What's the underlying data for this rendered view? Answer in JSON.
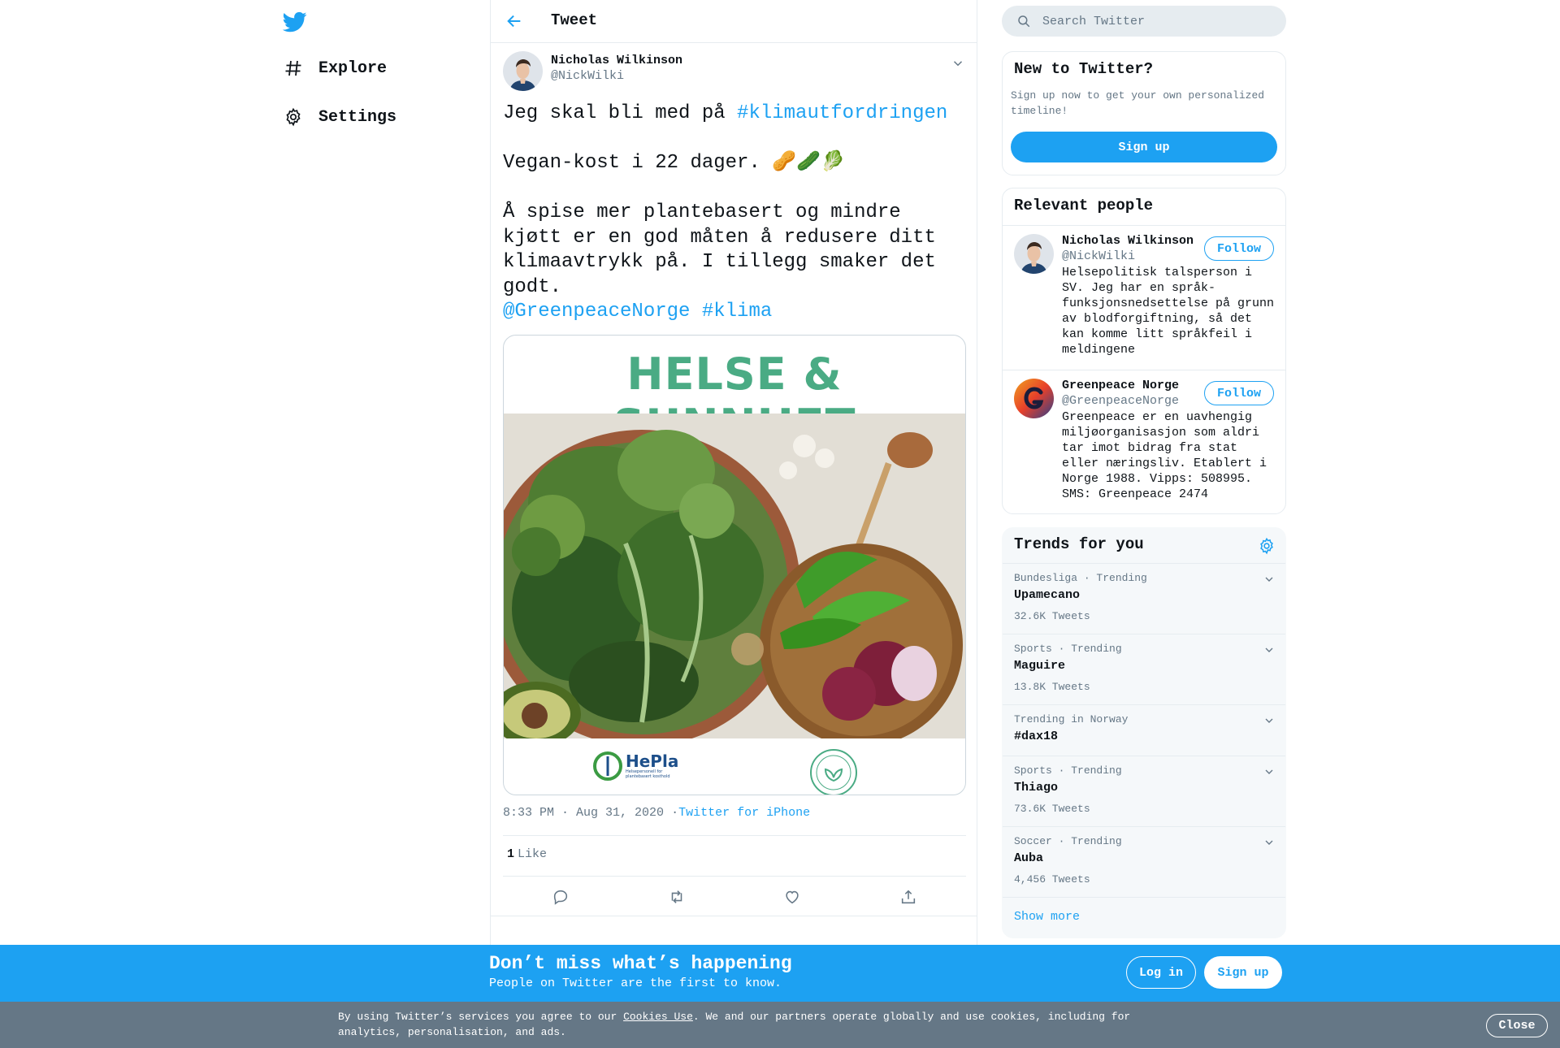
{
  "nav": {
    "logo": "twitter-bird-icon",
    "items": [
      {
        "label": "Explore",
        "icon": "hash-icon"
      },
      {
        "label": "Settings",
        "icon": "gear-icon"
      }
    ]
  },
  "header": {
    "title": "Tweet"
  },
  "tweet": {
    "author_name": "Nicholas Wilkinson",
    "author_handle": "@NickWilki",
    "text_prefix": "Jeg skal bli med på ",
    "hashtag_1": "#klimautfordringen",
    "line_2": "Vegan-kost i 22 dager. 🥜🥒🥬",
    "line_3": "Å spise mer plantebasert og mindre kjøtt er en god måten å redusere ditt klimaavtrykk på. I tillegg smaker det godt.",
    "mention": "@GreenpeaceNorge",
    "hashtag_2": "#klima",
    "media_headline": "HELSE & SUNNHET",
    "media_logo_1": "HePla",
    "media_logo_1_sub": "Helsepersonell for plantebasert kosthold",
    "timestamp": "8:33 PM · Aug 31, 2020",
    "dot": "·",
    "source": "Twitter for iPhone",
    "like_count": "1",
    "like_label": "Like",
    "actions": [
      "reply-icon",
      "retweet-icon",
      "like-icon",
      "share-icon"
    ]
  },
  "search": {
    "placeholder": "Search Twitter"
  },
  "new_to_twitter": {
    "title": "New to Twitter?",
    "desc": "Sign up now to get your own personalized timeline!",
    "button": "Sign up"
  },
  "relevant": {
    "title": "Relevant people",
    "people": [
      {
        "name": "Nicholas Wilkinson",
        "handle": "@NickWilki",
        "button": "Follow",
        "bio": "Helsepolitisk talsperson i SV. Jeg har en språk-funksjonsnedsettelse på grunn av blodforgiftning, så det kan komme litt språkfeil i meldingene"
      },
      {
        "name": "Greenpeace Norge",
        "handle": "@GreenpeaceNorge",
        "button": "Follow",
        "bio": "Greenpeace er en uavhengig miljøorganisasjon som aldri tar imot bidrag fra stat eller næringsliv. Etablert i Norge 1988. Vipps: 508995. SMS: Greenpeace 2474"
      }
    ]
  },
  "trends": {
    "title": "Trends for you",
    "items": [
      {
        "context": "Bundesliga · Trending",
        "name": "Upamecano",
        "count": "32.6K Tweets"
      },
      {
        "context": "Sports · Trending",
        "name": "Maguire",
        "count": "13.8K Tweets"
      },
      {
        "context": "Trending in Norway",
        "name": "#dax18",
        "count": ""
      },
      {
        "context": "Sports · Trending",
        "name": "Thiago",
        "count": "73.6K Tweets"
      },
      {
        "context": "Soccer · Trending",
        "name": "Auba",
        "count": "4,456 Tweets"
      }
    ],
    "show_more": "Show more"
  },
  "bottom": {
    "headline": "Don’t miss what’s happening",
    "sub": "People on Twitter are the first to know.",
    "login": "Log in",
    "signup": "Sign up"
  },
  "cookies": {
    "text_before": "By using Twitter’s services you agree to our ",
    "link": "Cookies Use",
    "text_after": ". We and our partners operate globally and use cookies, including for analytics, personalisation, and ads.",
    "close": "Close"
  },
  "colors": {
    "accent": "#1da1f2",
    "text": "#0f1419",
    "muted": "#657786",
    "border": "#e6ecf0",
    "headline_green": "#4aab84"
  }
}
